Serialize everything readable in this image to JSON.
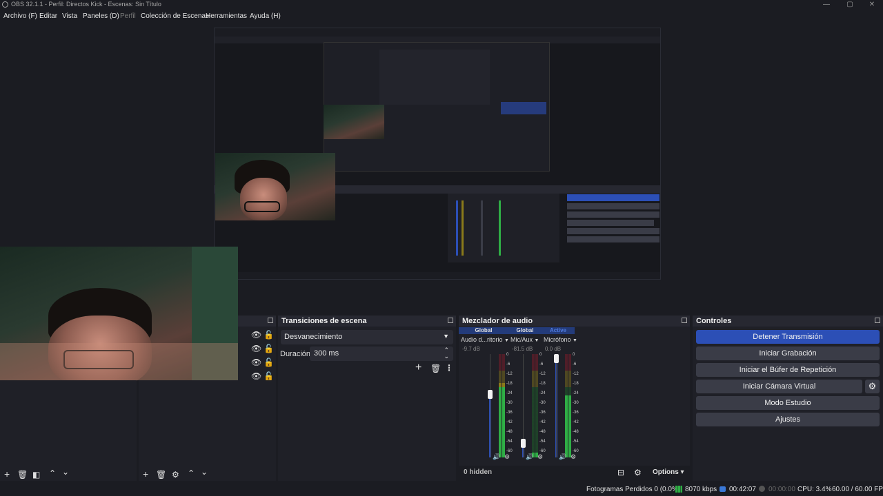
{
  "window": {
    "title": "OBS 32.1.1 - Perfil: Directos Kick - Escenas: Sin Título",
    "min_icon": "minimize-icon",
    "max_icon": "maximize-icon",
    "close_icon": "close-icon"
  },
  "menu": {
    "items": [
      "Archivo (F)",
      "Editar",
      "Vista",
      "Paneles (D)",
      "Perfil",
      "Colección de Escenas",
      "Herramientas",
      "Ayuda (H)"
    ],
    "disabled_index": 4
  },
  "transitions": {
    "title": "Transiciones de escena",
    "selected": "Desvanecimiento",
    "duration_label": "Duración",
    "duration_value": "300 ms"
  },
  "mixer": {
    "title": "Mezclador de audio",
    "channels": [
      {
        "tag": "Global",
        "name": "Audio d...ritorio",
        "db": "-9.7 dB",
        "level": 0.72,
        "volume": 0.62
      },
      {
        "tag": "Global",
        "name": "Mic/Aux",
        "db": "-81.5 dB",
        "level": 0.05,
        "volume": 0.1
      },
      {
        "tag": "Active",
        "name": "Micrófono",
        "db": "0.0 dB",
        "level": 0.6,
        "volume": 1.0
      }
    ],
    "ticks": [
      "0",
      "-6",
      "-12",
      "-18",
      "-24",
      "-30",
      "-36",
      "-42",
      "-48",
      "-54",
      "-60"
    ],
    "hidden": "0 hidden",
    "options": "Options",
    "colors": {
      "active_tag": "#4f7be0",
      "global_bar": "#2c4fb6"
    }
  },
  "controls": {
    "title": "Controles",
    "buttons": [
      "Detener Transmisión",
      "Iniciar Grabación",
      "Iniciar el Búfer de Repetición",
      "Iniciar Cámara Virtual",
      "Modo Estudio",
      "Ajustes"
    ],
    "accent": "#2c4fb6"
  },
  "status": {
    "dropped": "Fotogramas Perdidos 0 (0.0%)",
    "bitrate": "8070 kbps",
    "stream_time": "00:42:07",
    "rec_time": "00:00:00",
    "cpu": "CPU: 3.4%",
    "fps": "60.00 / 60.00 FPS"
  }
}
